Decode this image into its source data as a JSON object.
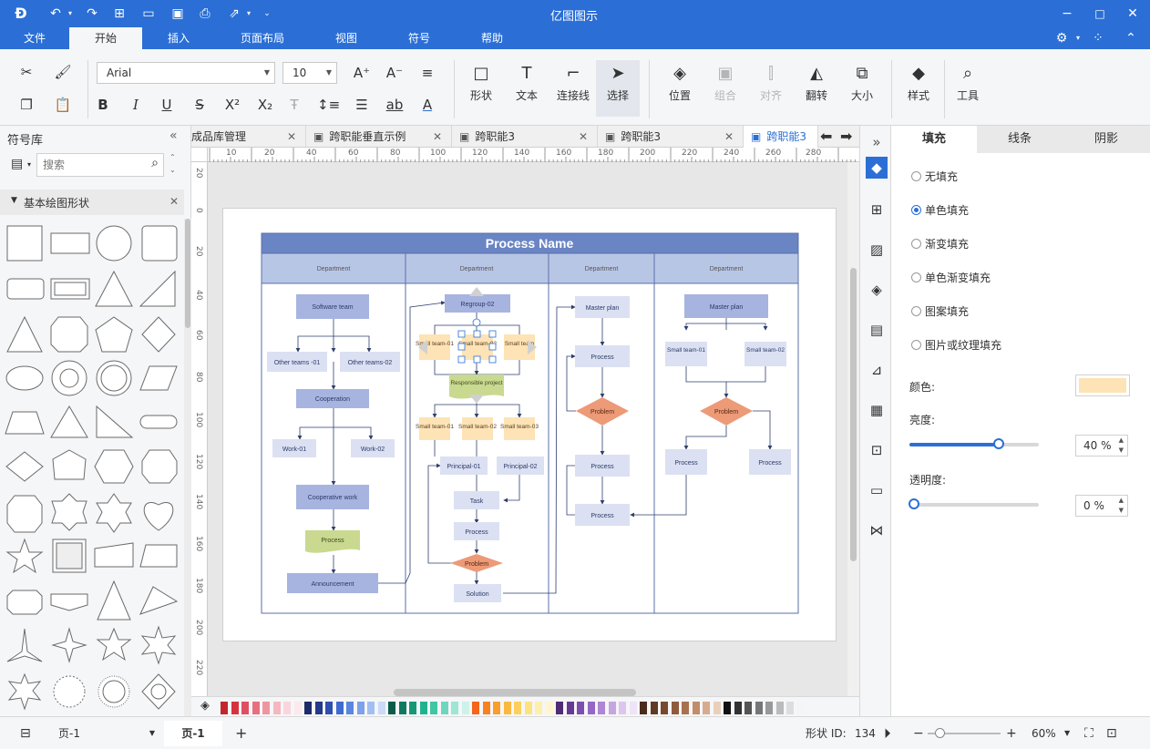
{
  "app_title": "亿图图示",
  "menu": [
    {
      "label": "文件"
    },
    {
      "label": "开始"
    },
    {
      "label": "插入"
    },
    {
      "label": "页面布局"
    },
    {
      "label": "视图"
    },
    {
      "label": "符号"
    },
    {
      "label": "帮助"
    }
  ],
  "ribbon": {
    "font_name": "Arial",
    "font_size": "10",
    "buttons": [
      {
        "label": "形状"
      },
      {
        "label": "文本"
      },
      {
        "label": "连接线"
      },
      {
        "label": "选择"
      },
      {
        "label": "位置"
      },
      {
        "label": "组合"
      },
      {
        "label": "对齐"
      },
      {
        "label": "翻转"
      },
      {
        "label": "大小"
      },
      {
        "label": "样式"
      },
      {
        "label": "工具"
      }
    ]
  },
  "library": {
    "title": "符号库",
    "search_placeholder": "搜索",
    "category": "基本绘图形状"
  },
  "tabs": [
    {
      "label": "成品库管理"
    },
    {
      "label": "跨职能垂直示例"
    },
    {
      "label": "跨职能3"
    },
    {
      "label": "跨职能3"
    },
    {
      "label": "跨职能3"
    }
  ],
  "ruler_h": [
    "10",
    "20",
    "40",
    "60",
    "80",
    "100",
    "120",
    "140",
    "160",
    "180",
    "200",
    "220",
    "240",
    "260",
    "280"
  ],
  "ruler_v": [
    "20",
    "0",
    "20",
    "40",
    "60",
    "80",
    "100",
    "120",
    "140",
    "160",
    "180",
    "200",
    "220"
  ],
  "diagram": {
    "title": "Process Name",
    "departments": [
      "Department",
      "Department",
      "Department",
      "Department"
    ],
    "nodes": {
      "software_team": "Software team",
      "other_teams_01": "Other teams -01",
      "other_teams_02": "Other teams-02",
      "cooperation": "Cooperation",
      "work_01": "Work-01",
      "work_02": "Work-02",
      "cooperative_work": "Cooperative work",
      "process_wave": "Process",
      "announcement": "Announcement",
      "regroup_02": "Regroup-02",
      "small_01a": "Small team-01",
      "small_02a": "Small team-02",
      "small_03a": "Small team",
      "responsible_project": "Responsible project",
      "small_01b": "Small team-01",
      "small_02b": "Small team-02",
      "small_03b": "Small team-03",
      "principal_01": "Principal-01",
      "principal_02": "Principal-02",
      "task": "Task",
      "process_l2": "Process",
      "problem_l2": "Problem",
      "solution": "Solution",
      "master_plan_3": "Master plan",
      "process_3a": "Process",
      "problem_3": "Problem",
      "process_3b": "Process",
      "process_3c": "Process",
      "master_plan_4": "Master plan",
      "small_4a": "Small team-01",
      "small_4b": "Small team-02",
      "problem_4": "Problem",
      "process_4a": "Process",
      "process_4b": "Process"
    }
  },
  "right_panel": {
    "tabs": [
      "填充",
      "线条",
      "阴影"
    ],
    "options": [
      "无填充",
      "单色填充",
      "渐变填充",
      "单色渐变填充",
      "图案填充",
      "图片或纹理填充"
    ],
    "selected_option": "单色填充",
    "color_label": "颜色:",
    "fill_color": "#fde3b5",
    "brightness_label": "亮度:",
    "brightness_value": "40 %",
    "brightness_fraction": 0.4,
    "transparency_label": "透明度:",
    "transparency_value": "0 %",
    "transparency_fraction": 0
  },
  "status": {
    "page_select": "页-1",
    "page_tab": "页-1",
    "shape_id_label": "形状 ID:",
    "shape_id": "134",
    "zoom": "60%"
  },
  "colors": {
    "accent": "#2b6fd6",
    "lane_header": "#6a85c4",
    "dept_header": "#b8c6e6",
    "node_blue": "#a7b4e0",
    "node_light": "#dbe1f2",
    "node_orange": "#fde3b5",
    "diamond": "#ec9a78",
    "wave": "#c9d98f"
  }
}
